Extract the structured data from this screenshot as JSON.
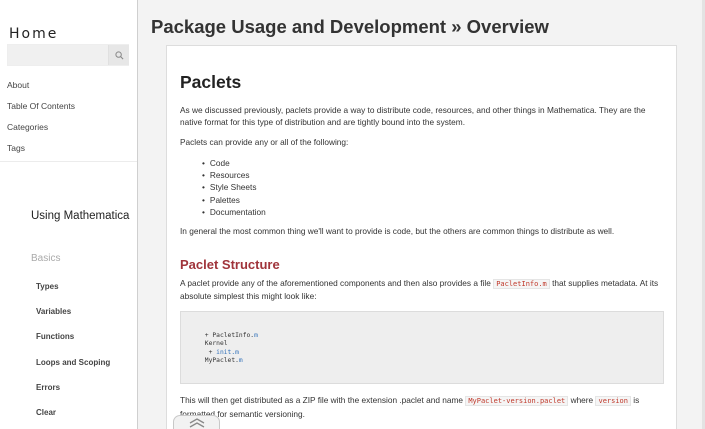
{
  "sidebar": {
    "site_title": "Home",
    "search": {
      "placeholder": "",
      "icon": "search-icon"
    },
    "nav_top": [
      "About",
      "Table Of Contents",
      "Categories",
      "Tags"
    ],
    "section_title": "Using Mathematica",
    "section_sub": "Basics",
    "nav_sub": [
      "Types",
      "Variables",
      "Functions",
      "Loops and Scoping",
      "Errors",
      "Clear"
    ]
  },
  "page": {
    "heading": "Package Usage and Development » Overview"
  },
  "article": {
    "title": "Paclets",
    "intro": "As we discussed previously, paclets provide a way to distribute code, resources, and other things in Mathematica. They are the native format for this type of distribution and are tightly bound into the system.",
    "provide_label": "Paclets can provide any or all of the following:",
    "bullets": [
      "Code",
      "Resources",
      "Style Sheets",
      "Palettes",
      "Documentation"
    ],
    "general": "In general the most common thing we'll want to provide is code, but the others are common things to distribute as well.",
    "structure_heading": "Paclet Structure",
    "structure_text_a": "A paclet provide any of the aforementioned components and then also provides a file ",
    "structure_code": "PacletInfo.m",
    "structure_text_b": " that supplies metadata. At its absolute simplest this might look like:",
    "code_lines": {
      "l1_prefix": " + PacletInfo.",
      "l1_ext": "m",
      "l2": " Kernel",
      "l3_prefix": "  + ",
      "l3_ext": "init.m",
      "l4_prefix": " MyPaclet.",
      "l4_ext": "m"
    },
    "zip_text_a": "This will then get distributed as a ZIP file with the extension .paclet and name ",
    "zip_code": "MyPaclet-version.paclet",
    "zip_text_b": " where ",
    "version_code": "version",
    "zip_text_c": " is formatted for semantic versioning."
  },
  "colors": {
    "accent_heading": "#a0343b",
    "code_inline": "#c0392b",
    "code_ext": "#2f6fb8"
  }
}
